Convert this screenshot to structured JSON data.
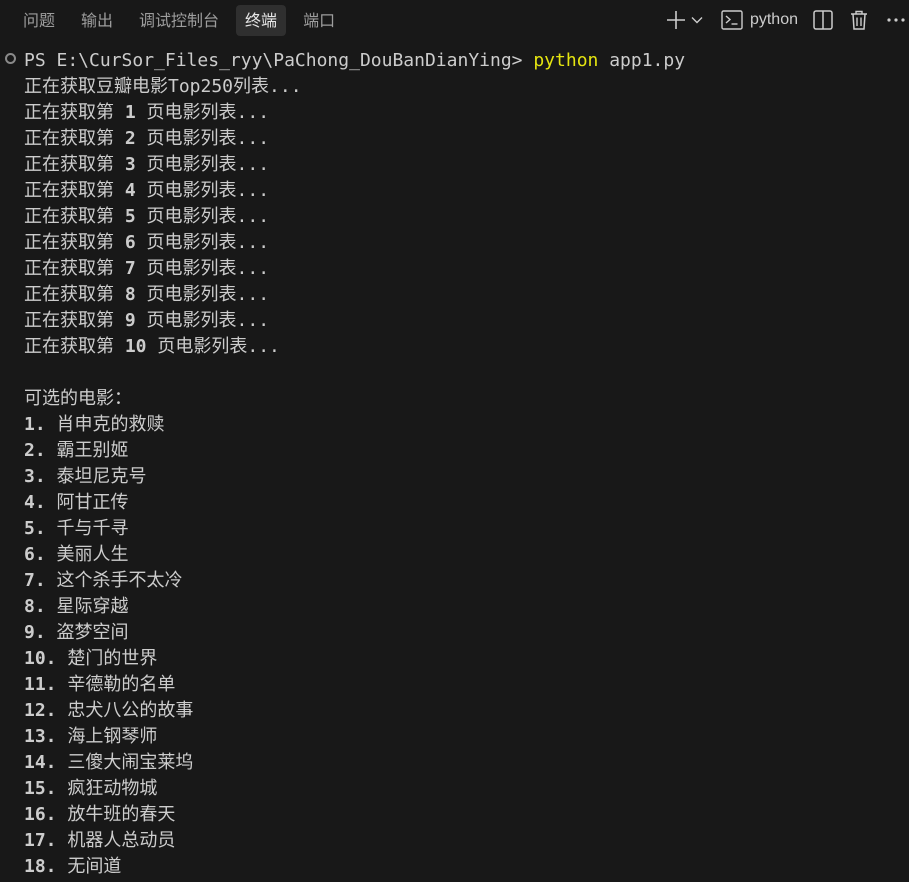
{
  "tabs": [
    {
      "label": "问题",
      "active": false
    },
    {
      "label": "输出",
      "active": false
    },
    {
      "label": "调试控制台",
      "active": false
    },
    {
      "label": "终端",
      "active": true
    },
    {
      "label": "端口",
      "active": false
    }
  ],
  "toolbar": {
    "terminal_name": "python",
    "icons": [
      "plus-icon",
      "chevron-down-icon",
      "terminal-icon",
      "split-icon",
      "trash-icon",
      "more-icon"
    ]
  },
  "colors": {
    "background": "#181818",
    "text": "#cccccc",
    "command_highlight": "#e5e510",
    "active_tab_bg": "#2f2f2f"
  },
  "terminal": {
    "prompt": "PS E:\\CurSor_Files_ryy\\PaChong_DouBanDianYing> ",
    "command_exe": "python",
    "command_args": " app1.py",
    "header_line": "正在获取豆瓣电影Top250列表...",
    "page_prefix": "正在获取第 ",
    "page_suffix": " 页电影列表...",
    "pages": [
      "1",
      "2",
      "3",
      "4",
      "5",
      "6",
      "7",
      "8",
      "9",
      "10"
    ],
    "list_title": "可选的电影：",
    "movies": [
      {
        "num": "1.",
        "title": "肖申克的救赎"
      },
      {
        "num": "2.",
        "title": "霸王别姬"
      },
      {
        "num": "3.",
        "title": "泰坦尼克号"
      },
      {
        "num": "4.",
        "title": "阿甘正传"
      },
      {
        "num": "5.",
        "title": "千与千寻"
      },
      {
        "num": "6.",
        "title": "美丽人生"
      },
      {
        "num": "7.",
        "title": "这个杀手不太冷"
      },
      {
        "num": "8.",
        "title": "星际穿越"
      },
      {
        "num": "9.",
        "title": "盗梦空间"
      },
      {
        "num": "10.",
        "title": "楚门的世界"
      },
      {
        "num": "11.",
        "title": "辛德勒的名单"
      },
      {
        "num": "12.",
        "title": "忠犬八公的故事"
      },
      {
        "num": "13.",
        "title": "海上钢琴师"
      },
      {
        "num": "14.",
        "title": "三傻大闹宝莱坞"
      },
      {
        "num": "15.",
        "title": "疯狂动物城"
      },
      {
        "num": "16.",
        "title": "放牛班的春天"
      },
      {
        "num": "17.",
        "title": "机器人总动员"
      },
      {
        "num": "18.",
        "title": "无间道"
      }
    ]
  }
}
